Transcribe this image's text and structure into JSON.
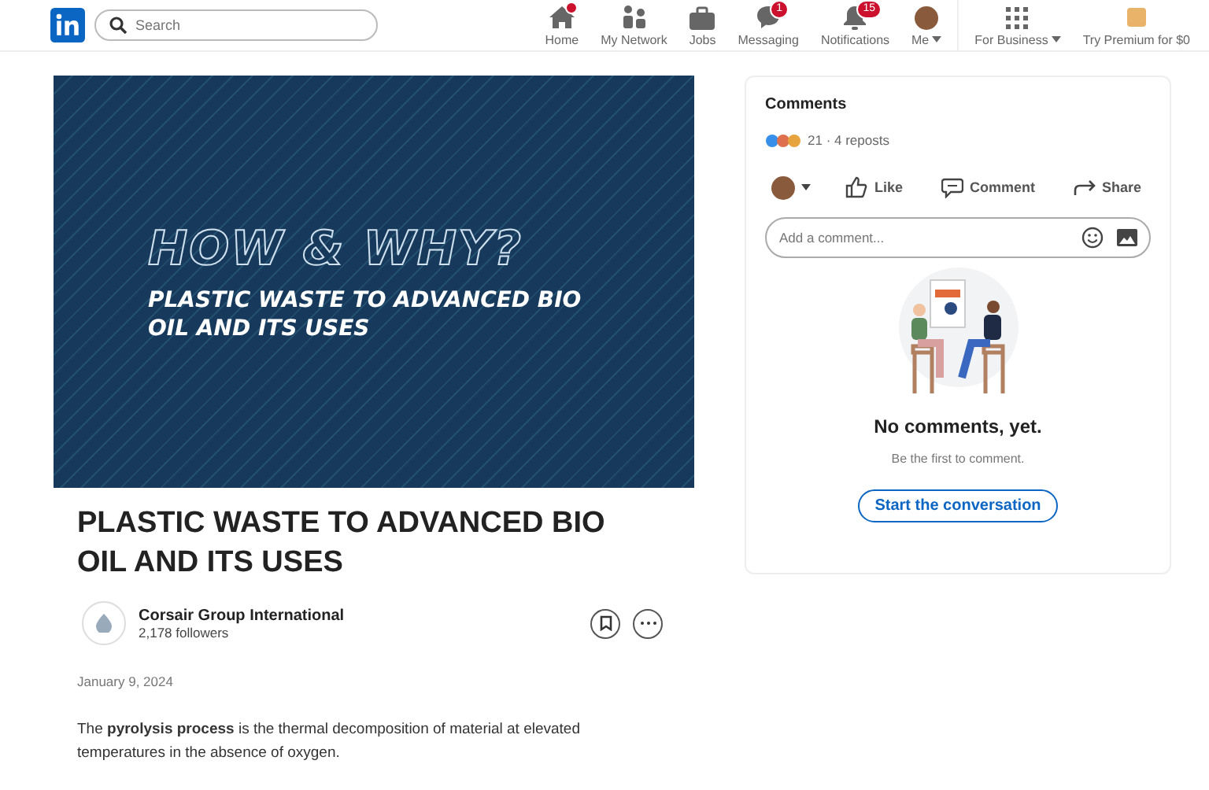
{
  "nav": {
    "search": {
      "placeholder": "Search"
    },
    "items": [
      {
        "kind": "home",
        "label": "Home",
        "badge_dot": true
      },
      {
        "kind": "network",
        "label": "My Network"
      },
      {
        "kind": "jobs",
        "label": "Jobs"
      },
      {
        "kind": "messaging",
        "label": "Messaging",
        "badge": "1"
      },
      {
        "kind": "notifications",
        "label": "Notifications",
        "badge": "15"
      },
      {
        "kind": "me",
        "label": "Me"
      }
    ],
    "business": {
      "label": "For Business"
    },
    "premium": {
      "label": "Try Premium for $0"
    }
  },
  "article": {
    "banner": {
      "heading": "HOW & WHY?",
      "subheading": "PLASTIC WASTE TO ADVANCED BIO OIL AND ITS USES"
    },
    "title": "PLASTIC WASTE TO ADVANCED BIO OIL AND ITS USES",
    "author": {
      "name": "Corsair Group International",
      "followers": "2,178 followers"
    },
    "date": "January 9, 2024",
    "body": "The **pyrolysis process** is the thermal decomposition of material at elevated temperatures in the absence of oxygen."
  },
  "comments": {
    "title": "Comments",
    "stats": "21 · 4 reposts",
    "actions": [
      {
        "kind": "like",
        "label": "Like"
      },
      {
        "kind": "comment",
        "label": "Comment"
      },
      {
        "kind": "share",
        "label": "Share"
      }
    ],
    "input": {
      "placeholder": "Add a comment..."
    },
    "empty": {
      "title": "No comments, yet.",
      "subtitle": "Be the first to comment.",
      "button": "Start the conversation"
    }
  }
}
